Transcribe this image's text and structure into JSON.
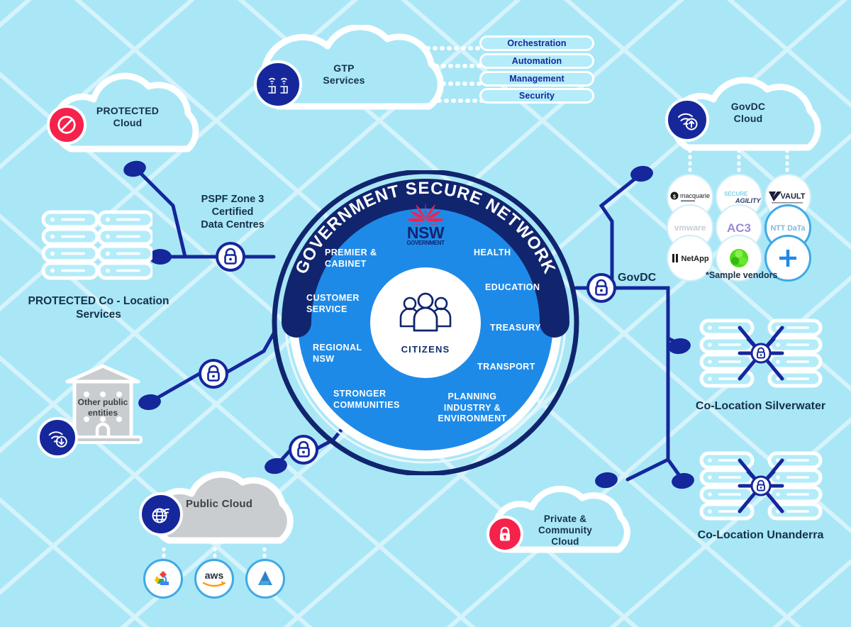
{
  "colors": {
    "background": "#a9e7f7",
    "navy": "#15279b",
    "deep_navy": "#11256e",
    "wheel_blue": "#1e8ae8",
    "cloud_fill": "#a9e7f7",
    "grey_cloud": "#c9cdd0",
    "red": "#f5224b",
    "white": "#ffffff",
    "text_dark": "#16314a"
  },
  "wheel": {
    "banner": "GOVERNMENT SECURE NETWORK",
    "logo": {
      "name": "nsw-government-logo",
      "line1": "NSW",
      "line2": "GOVERNMENT"
    },
    "center": {
      "label": "CITIZENS",
      "icon": "citizens-group-icon"
    },
    "departments_left": [
      "PREMIER &\nCABINET",
      "CUSTOMER\nSERVICE",
      "REGIONAL\nNSW",
      "STRONGER\nCOMMUNITIES"
    ],
    "departments_right": [
      "HEALTH",
      "EDUCATION",
      "TREASURY",
      "TRANSPORT",
      "PLANNING\nINDUSTRY &\nENVIRONMENT"
    ]
  },
  "gtp": {
    "cloud_label": "GTP\nServices",
    "icon": "gtp-services-icon",
    "capabilities": [
      "Orchestration",
      "Automation",
      "Management",
      "Security"
    ]
  },
  "protected_cloud": {
    "label": "PROTECTED\nCloud",
    "icon": "no-entry-icon"
  },
  "govdc_cloud": {
    "label": "GovDC\nCloud",
    "icon": "wifi-upload-icon",
    "vendors_note": "*Sample vendors",
    "vendors": [
      [
        "Macquarie",
        "SecureAgility",
        "Vault"
      ],
      [
        "vmware",
        "AC3",
        "NTT DaTa"
      ],
      [
        "NetApp",
        "Nutanix",
        "Plus"
      ]
    ]
  },
  "protected_colocation": {
    "label": "PROTECTED Co - Location\nServices",
    "icon": "server-rack-icon"
  },
  "pspf": {
    "label": "PSPF Zone 3\nCertified\nData Centres",
    "icon": "lock-icon"
  },
  "other_entities": {
    "label": "Other public\nentities",
    "icon": "building-icon",
    "badge_icon": "wifi-download-icon"
  },
  "public_cloud": {
    "label": "Public Cloud",
    "icon": "globe-wifi-icon",
    "providers": [
      "Google Cloud",
      "aws",
      "Azure"
    ]
  },
  "private_cloud": {
    "label": "Private &\nCommunity\nCloud",
    "icon": "padlock-icon"
  },
  "govdc": {
    "label": "GovDC",
    "icon": "lock-icon"
  },
  "colocations": [
    {
      "label": "Co-Location Silverwater",
      "icon": "server-mesh-icon"
    },
    {
      "label": "Co-Location Unanderra",
      "icon": "server-mesh-icon"
    }
  ],
  "lock_nodes": [
    {
      "name": "lock-pspf",
      "label": ""
    },
    {
      "name": "lock-other-entities",
      "label": ""
    },
    {
      "name": "lock-public-cloud",
      "label": ""
    },
    {
      "name": "lock-govdc",
      "label": "GovDC"
    }
  ]
}
